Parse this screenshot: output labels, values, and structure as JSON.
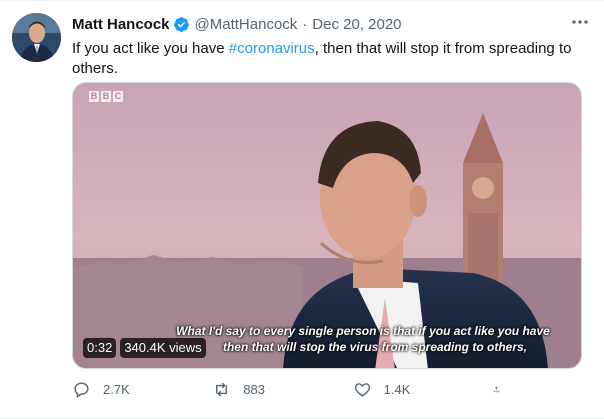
{
  "tweet": {
    "author_name": "Matt Hancock",
    "handle": "@MattHancock",
    "separator": "·",
    "date": "Dec 20, 2020",
    "text_before": "If you act like you have ",
    "hashtag": "#coronavirus",
    "text_after": ", then that will stop it from spreading to others."
  },
  "media": {
    "logo_letters": [
      "B",
      "B",
      "C"
    ],
    "subtitle_line1": "What I'd say to every single person is that if you act like you have",
    "subtitle_line2": "then that will stop the virus from spreading to others,",
    "duration": "0:32",
    "views": "340.4K views"
  },
  "actions": {
    "reply_count": "2.7K",
    "retweet_count": "883",
    "like_count": "1.4K"
  },
  "icons": {
    "verified": "verified-badge-icon",
    "more": "more-dots-icon",
    "reply": "reply-icon",
    "retweet": "retweet-icon",
    "like": "heart-icon",
    "share": "share-icon"
  },
  "colors": {
    "accent": "#1d9bf0",
    "secondary_text": "#536471",
    "primary_text": "#0f1419"
  }
}
